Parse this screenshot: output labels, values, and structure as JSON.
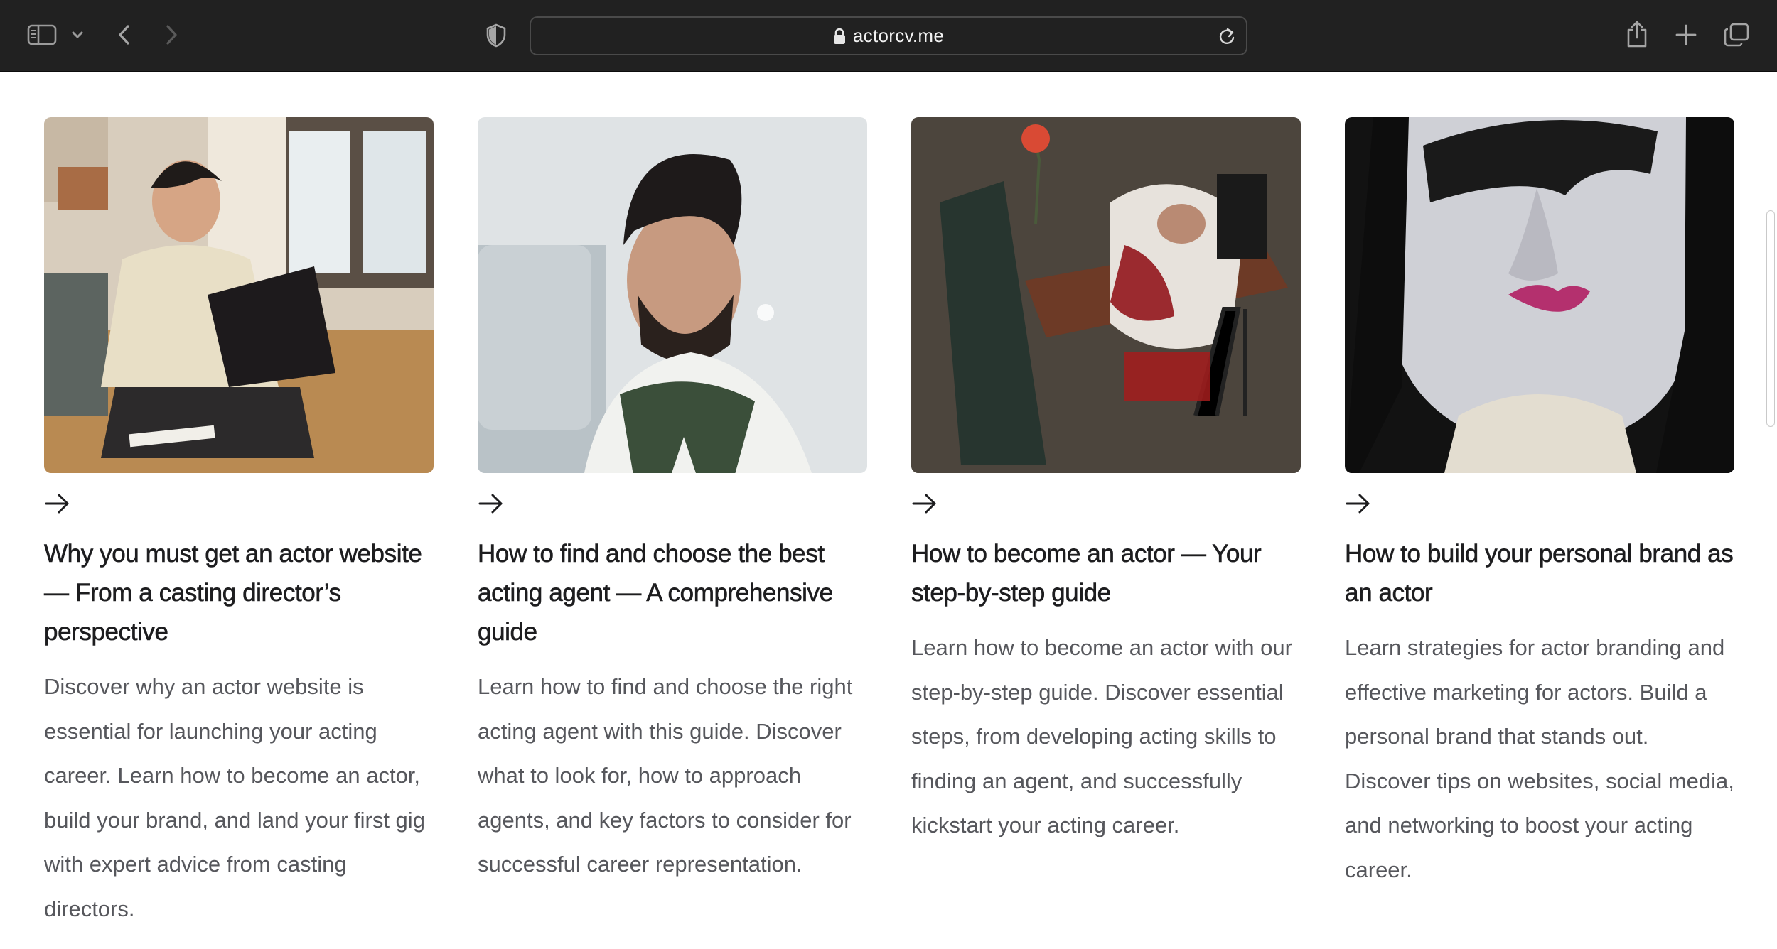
{
  "browser": {
    "url": "actorcv.me",
    "icons": {
      "sidebar": "sidebar-icon",
      "back": "chevron-left-icon",
      "forward": "chevron-right-icon",
      "privacy": "shield-icon",
      "lock": "lock-icon",
      "reload": "reload-icon",
      "share": "share-icon",
      "new_tab": "plus-icon",
      "tabs": "tab-overview-icon"
    }
  },
  "articles": [
    {
      "title": "Why you must get an actor website — From a casting director’s perspective",
      "description": "Discover why an actor website is essential for launching your acting career. Learn how to become an actor, build your brand, and land your first gig with expert advice from casting directors."
    },
    {
      "title": "How to find and choose the best acting agent — A comprehensive guide",
      "description": "Learn how to find and choose the right acting agent with this guide. Discover what to look for, how to approach agents, and key factors to consider for successful career representation."
    },
    {
      "title": "How to become an actor — Your step-by-step guide",
      "description": "Learn how to become an actor with our step-by-step guide. Discover essential steps, from developing acting skills to finding an agent, and successfully kickstart your acting career."
    },
    {
      "title": "How to build your personal brand as an actor",
      "description": "Learn strategies for actor branding and effective marketing for actors. Build a personal brand that stands out. Discover tips on websites, social media, and networking to boost your acting career."
    }
  ]
}
